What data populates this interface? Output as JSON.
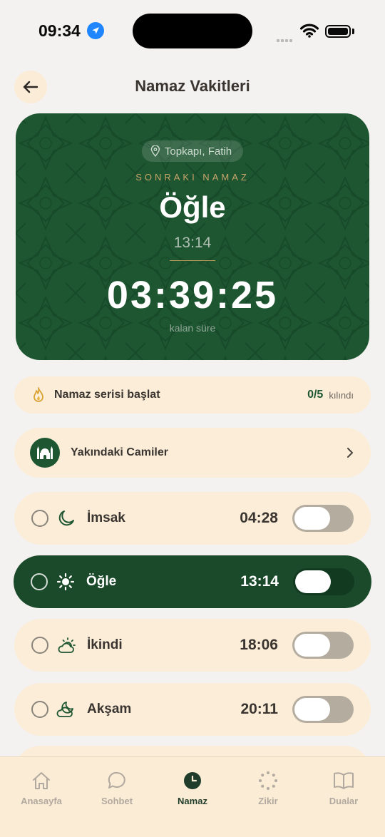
{
  "status_bar": {
    "time": "09:34"
  },
  "header": {
    "title": "Namaz Vakitleri"
  },
  "hero": {
    "location": "Topkapı, Fatih",
    "label": "SONRAKI NAMAZ",
    "prayer_name": "Öğle",
    "prayer_time": "13:14",
    "countdown": "03:39:25",
    "countdown_label": "kalan süre"
  },
  "streak": {
    "label": "Namaz serisi başlat",
    "count": "0/5",
    "suffix": "kılındı"
  },
  "mosques": {
    "label": "Yakındaki Camiler"
  },
  "prayers": [
    {
      "name": "İmsak",
      "time": "04:28",
      "icon": "moon-icon",
      "active": false,
      "notification": false
    },
    {
      "name": "Öğle",
      "time": "13:14",
      "icon": "sun-icon",
      "active": true,
      "notification": false
    },
    {
      "name": "İkindi",
      "time": "18:06",
      "icon": "sun-cloud-icon",
      "active": false,
      "notification": false
    },
    {
      "name": "Akşam",
      "time": "20:11",
      "icon": "moon-cloud-icon",
      "active": false,
      "notification": false
    }
  ],
  "tabs": [
    {
      "label": "Anasayfa",
      "icon": "home-icon",
      "active": false
    },
    {
      "label": "Sohbet",
      "icon": "chat-icon",
      "active": false
    },
    {
      "label": "Namaz",
      "icon": "clock-icon",
      "active": true
    },
    {
      "label": "Zikir",
      "icon": "prayer-beads-icon",
      "active": false
    },
    {
      "label": "Dualar",
      "icon": "book-icon",
      "active": false
    }
  ],
  "colors": {
    "primary_green": "#1f5632",
    "active_row": "#1b4a2b",
    "card_beige": "#fbedd8",
    "gold": "#c9a56a",
    "background": "#f3f2f0"
  }
}
